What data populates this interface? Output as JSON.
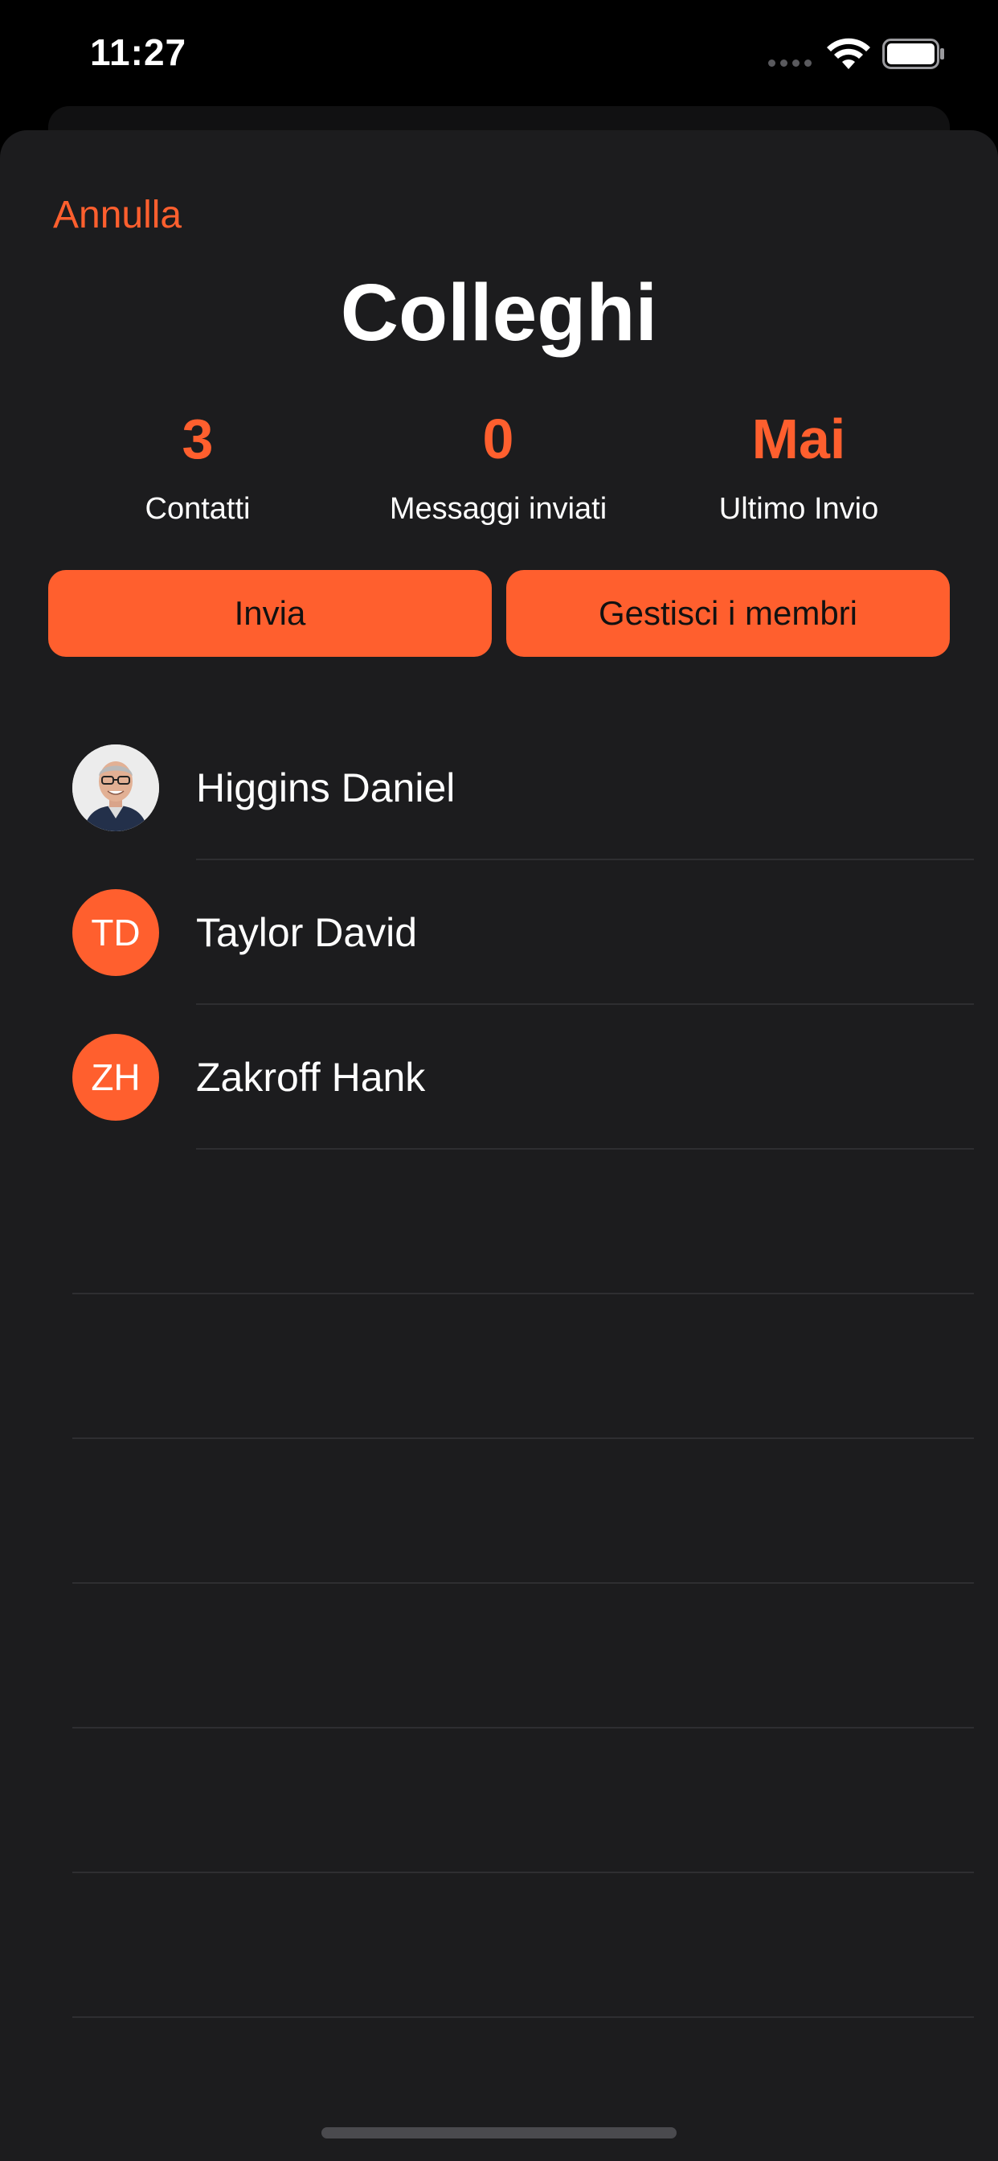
{
  "status_bar": {
    "time": "11:27"
  },
  "sheet": {
    "cancel_label": "Annulla",
    "title": "Colleghi"
  },
  "stats": [
    {
      "value": "3",
      "label": "Contatti"
    },
    {
      "value": "0",
      "label": "Messaggi inviati"
    },
    {
      "value": "Mai",
      "label": "Ultimo Invio"
    }
  ],
  "actions": {
    "send_label": "Invia",
    "manage_label": "Gestisci i membri"
  },
  "contacts": [
    {
      "name": "Higgins Daniel",
      "initials": "",
      "avatar": "photo"
    },
    {
      "name": "Taylor David",
      "initials": "TD",
      "avatar": "initials"
    },
    {
      "name": "Zakroff Hank",
      "initials": "ZH",
      "avatar": "initials"
    }
  ],
  "colors": {
    "accent": "#ff5f2e",
    "sheet_background": "#1c1c1e",
    "screen_background": "#000000"
  }
}
